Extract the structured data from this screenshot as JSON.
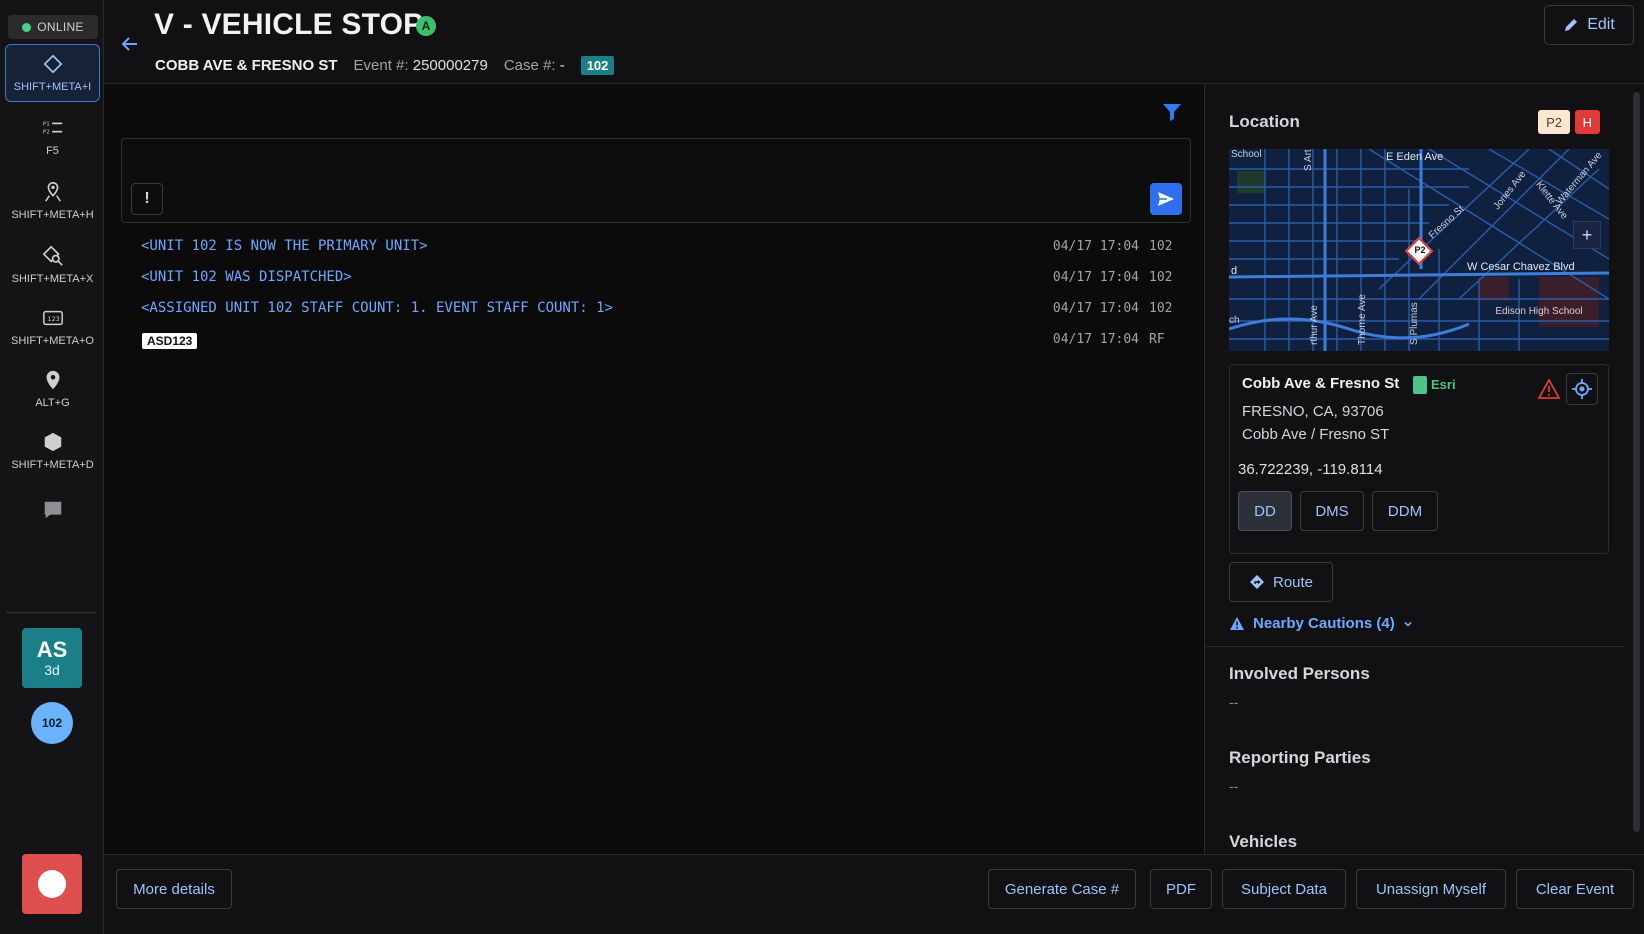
{
  "rail": {
    "online_label": "ONLINE",
    "items": [
      {
        "icon": "diamond-icon",
        "label": "SHIFT+META+I"
      },
      {
        "icon": "priority-list-icon",
        "label": "F5"
      },
      {
        "icon": "map-pin-person-icon",
        "label": "SHIFT+META+H"
      },
      {
        "icon": "location-search-icon",
        "label": "SHIFT+META+X"
      },
      {
        "icon": "numeric-keypad-icon",
        "label": "SHIFT+META+O"
      },
      {
        "icon": "map-marker-icon",
        "label": "ALT+G"
      },
      {
        "icon": "hexagon-icon",
        "label": "SHIFT+META+D"
      },
      {
        "icon": "chat-icon",
        "label": ""
      }
    ],
    "avatar_initials": "AS",
    "avatar_sub": "3d",
    "unit_circle": "102"
  },
  "header": {
    "title": "V - VEHICLE STOP",
    "status_letter": "A",
    "address": "COBB AVE & FRESNO ST",
    "event_label": "Event #:",
    "event_number": "250000279",
    "case_label": "Case #:",
    "case_value": "-",
    "unit_tag": "102",
    "edit_label": "Edit"
  },
  "composer": {
    "placeholder": "",
    "priority_symbol": "!"
  },
  "log": [
    {
      "message": "<UNIT 102 IS NOW THE PRIMARY UNIT>",
      "time": "04/17 17:04",
      "source": "102"
    },
    {
      "message": "<UNIT 102 WAS DISPATCHED>",
      "time": "04/17 17:04",
      "source": "102"
    },
    {
      "message": "<ASSIGNED UNIT 102 STAFF COUNT: 1. EVENT STAFF COUNT: 1>",
      "time": "04/17 17:04",
      "source": "102"
    },
    {
      "plate": "ASD123",
      "time": "04/17 17:04",
      "source": "RF"
    }
  ],
  "location": {
    "title": "Location",
    "priority_badge": "P2",
    "h_badge": "H",
    "map_labels": {
      "school": "School",
      "eden": "E Eden Ave",
      "arthur_top": "S Arthur A",
      "jones": "Jones Ave",
      "klette": "Klette Ave",
      "waterman": "Waterman Ave",
      "fresno": "Fresno St",
      "cesar": "W Cesar Chavez Blvd",
      "arthur_bottom": "rthur Ave",
      "thorne": "Thorne Ave",
      "plumas": "S Plumas",
      "edison": "Edison High School",
      "d": "d",
      "ch": "ch",
      "pin": "P2",
      "zoom_in": "+"
    },
    "name": "Cobb Ave & Fresno St",
    "provider": "Esri",
    "city_line": "FRESNO, CA, 93706",
    "cross_streets": "Cobb Ave / Fresno ST",
    "coordinates": "36.722239, -119.8114",
    "formats": [
      "DD",
      "DMS",
      "DDM"
    ],
    "route_label": "Route",
    "cautions_label": "Nearby Cautions (4)"
  },
  "sections": {
    "involved_title": "Involved Persons",
    "involved_value": "--",
    "reporting_title": "Reporting Parties",
    "reporting_value": "--",
    "vehicles_title": "Vehicles"
  },
  "footer": {
    "more_details": "More details",
    "generate_case": "Generate Case #",
    "pdf": "PDF",
    "subject_data": "Subject Data",
    "unassign": "Unassign Myself",
    "clear_event": "Clear Event"
  },
  "colors": {
    "accent_blue": "#6fa7ff",
    "primary_button": "#2f6fed",
    "online_green": "#4cd37f",
    "unit_teal": "#1b7f88",
    "alert_red": "#e03a3a"
  }
}
